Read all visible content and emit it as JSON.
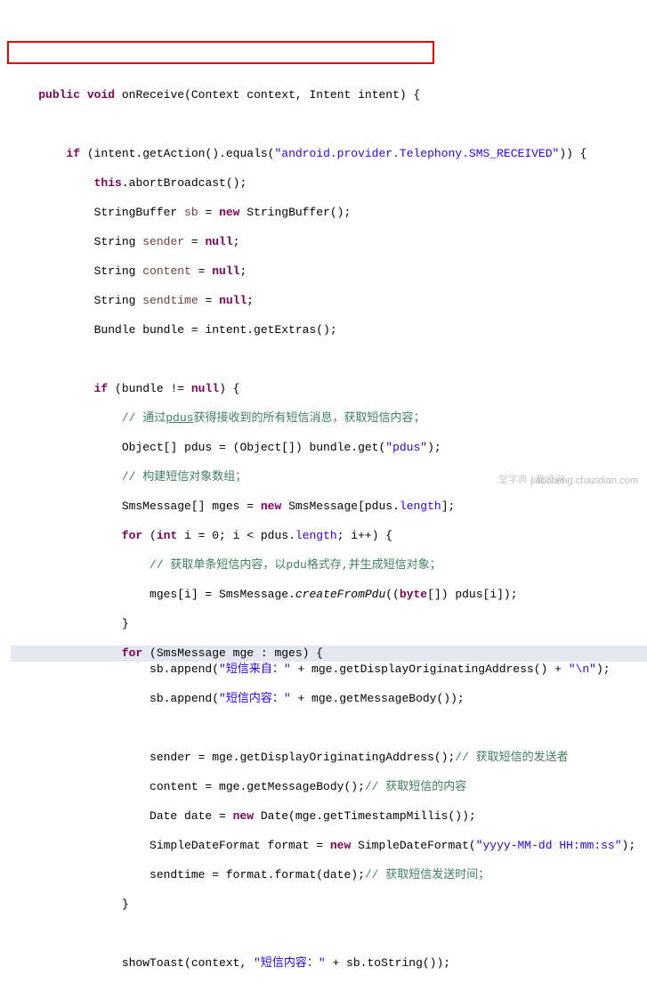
{
  "code": {
    "l1a": "public",
    "l1b": "void",
    "l1c": " onReceive(Context context, Intent intent) {",
    "l2": "",
    "l3a": "if",
    "l3b": " (intent.getAction().equals(",
    "l3c": "\"android.provider.Telephony.SMS_RECEIVED\"",
    "l3d": ")) {",
    "l4a": "this",
    "l4b": ".abortBroadcast();",
    "l5a": "            StringBuffer ",
    "l5v": "sb",
    "l5b": " = ",
    "l5c": "new",
    "l5d": " StringBuffer();",
    "l6a": "            String ",
    "l6v": "sender",
    "l6b": " = ",
    "l6c": "null",
    "l6d": ";",
    "l7a": "            String ",
    "l7v": "content",
    "l7b": " = ",
    "l7c": "null",
    "l7d": ";",
    "l8a": "            String ",
    "l8v": "sendtime",
    "l8b": " = ",
    "l8c": "null",
    "l8d": ";",
    "l9a": "            Bundle bundle = intent.getExtras();",
    "l10": "",
    "l11a": "if",
    "l11b": " (bundle != ",
    "l11c": "null",
    "l11d": ") {",
    "l12a": "// 通过",
    "l12b": "pdus",
    "l12c": "获得接收到的所有短信消息，获取短信内容；",
    "l13a": "                Object[] pdus = (Object[]) bundle.get(",
    "l13b": "\"pdus\"",
    "l13c": ");",
    "l14": "// 构建短信对象数组；",
    "l15a": "                SmsMessage[] mges = ",
    "l15b": "new",
    "l15c": " SmsMessage[pdus.",
    "l15d": "length",
    "l15e": "];",
    "l16a": "for",
    "l16b": " (",
    "l16c": "int",
    "l16d": " i = 0; i < pdus.",
    "l16e": "length",
    "l16f": "; i++) {",
    "l17": "// 获取单条短信内容，以pdu格式存,并生成短信对象；",
    "l18a": "                    mges[i] = SmsMessage.",
    "l18b": "createFromPdu",
    "l18c": "((",
    "l18d": "byte",
    "l18e": "[]) pdus[i]);",
    "l19": "                }",
    "l20a": "for",
    "l20b": " (SmsMessage mge : mges) {",
    "l21a": "                    sb.append(",
    "l21b": "\"短信来自：\"",
    "l21c": " + mge.getDisplayOriginatingAddress() + ",
    "l21d": "\"\\n\"",
    "l21e": ");",
    "l22a": "                    sb.append(",
    "l22b": "\"短信内容：\"",
    "l22c": " + mge.getMessageBody());",
    "l23": "",
    "l24a": "                    sender = mge.getDisplayOriginatingAddress();",
    "l24b": "// 获取短信的发送者",
    "l25a": "                    content = mge.getMessageBody();",
    "l25b": "// 获取短信的内容",
    "l26a": "                    Date date = ",
    "l26b": "new",
    "l26c": " Date(mge.getTimestampMillis());",
    "l27a": "                    SimpleDateFormat format = ",
    "l27b": "new",
    "l27c": " SimpleDateFormat(",
    "l27d": "\"yyyy-MM-dd HH:mm:ss\"",
    "l27e": ");",
    "l28a": "                    sendtime = format.format(date);",
    "l28b": "// 获取短信发送时间；",
    "l29": "                }",
    "l30": "",
    "l31a": "                showToast(context, ",
    "l31b": "\"短信内容：\"",
    "l31c": " + sb.toString());"
  },
  "watermark1": "堂字典 | 教室网",
  "watermark2": "jiaocheng.chazidian.com"
}
